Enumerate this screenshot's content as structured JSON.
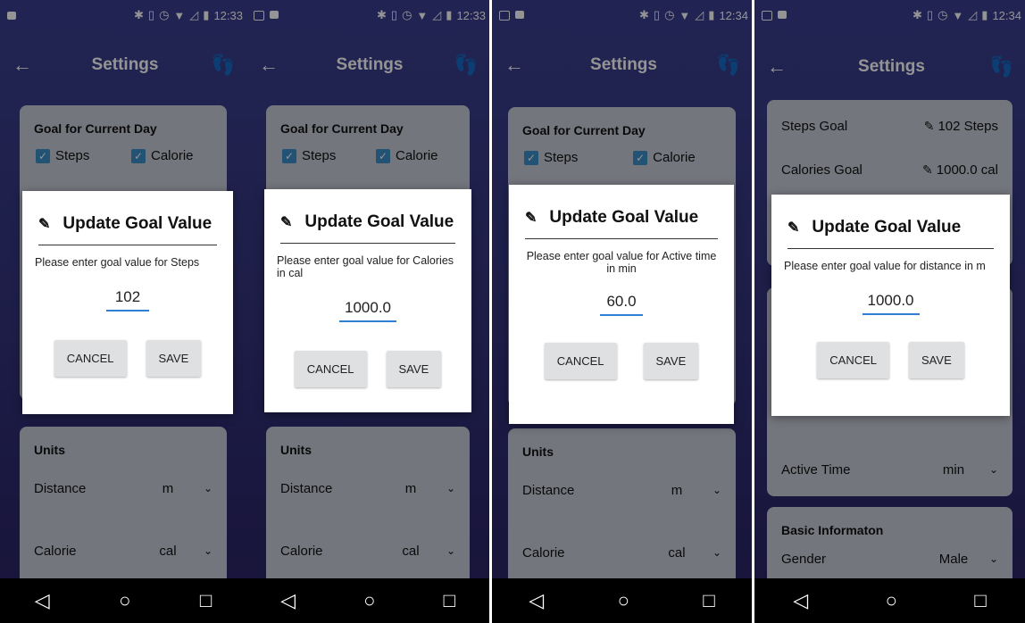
{
  "common": {
    "title": "Settings",
    "back_icon": "←",
    "steps_icon": "👣",
    "dialog_title": "Update Goal Value",
    "cancel_label": "CANCEL",
    "save_label": "SAVE",
    "nav_back": "◁",
    "nav_home": "○",
    "nav_recent": "□",
    "edit_icon": "✎",
    "check_mark": "✓"
  },
  "panels": [
    {
      "time": "12:33",
      "goal_header": "Goal for Current Day",
      "check1": "Steps",
      "check2": "Calorie",
      "dialog_message": "Please enter goal value for Steps",
      "input_value": "102",
      "units_header": "Units",
      "units": [
        {
          "label": "Distance",
          "value": "m"
        },
        {
          "label": "Calorie",
          "value": "cal"
        }
      ]
    },
    {
      "time": "12:33",
      "goal_header": "Goal for Current Day",
      "check1": "Steps",
      "check2": "Calorie",
      "dialog_message": "Please enter goal value for Calories in cal",
      "input_value": "1000.0",
      "units_header": "Units",
      "units": [
        {
          "label": "Distance",
          "value": "m"
        },
        {
          "label": "Calorie",
          "value": "cal"
        }
      ]
    },
    {
      "time": "12:34",
      "goal_header": "Goal for Current Day",
      "check1": "Steps",
      "check2": "Calorie",
      "dialog_message": "Please enter goal value for Active time in min",
      "input_value": "60.0",
      "units_header": "Units",
      "units": [
        {
          "label": "Distance",
          "value": "m"
        },
        {
          "label": "Calorie",
          "value": "cal"
        }
      ]
    },
    {
      "time": "12:34",
      "goals": [
        {
          "label": "Steps Goal",
          "value": "102  Steps"
        },
        {
          "label": "Calories Goal",
          "value": "1000.0  cal"
        }
      ],
      "dialog_message": "Please enter goal value for distance in m",
      "input_value": "1000.0",
      "active_time_label": "Active Time",
      "active_time_value": "min",
      "basic_header": "Basic Informaton",
      "gender_label": "Gender",
      "gender_value": "Male"
    }
  ]
}
